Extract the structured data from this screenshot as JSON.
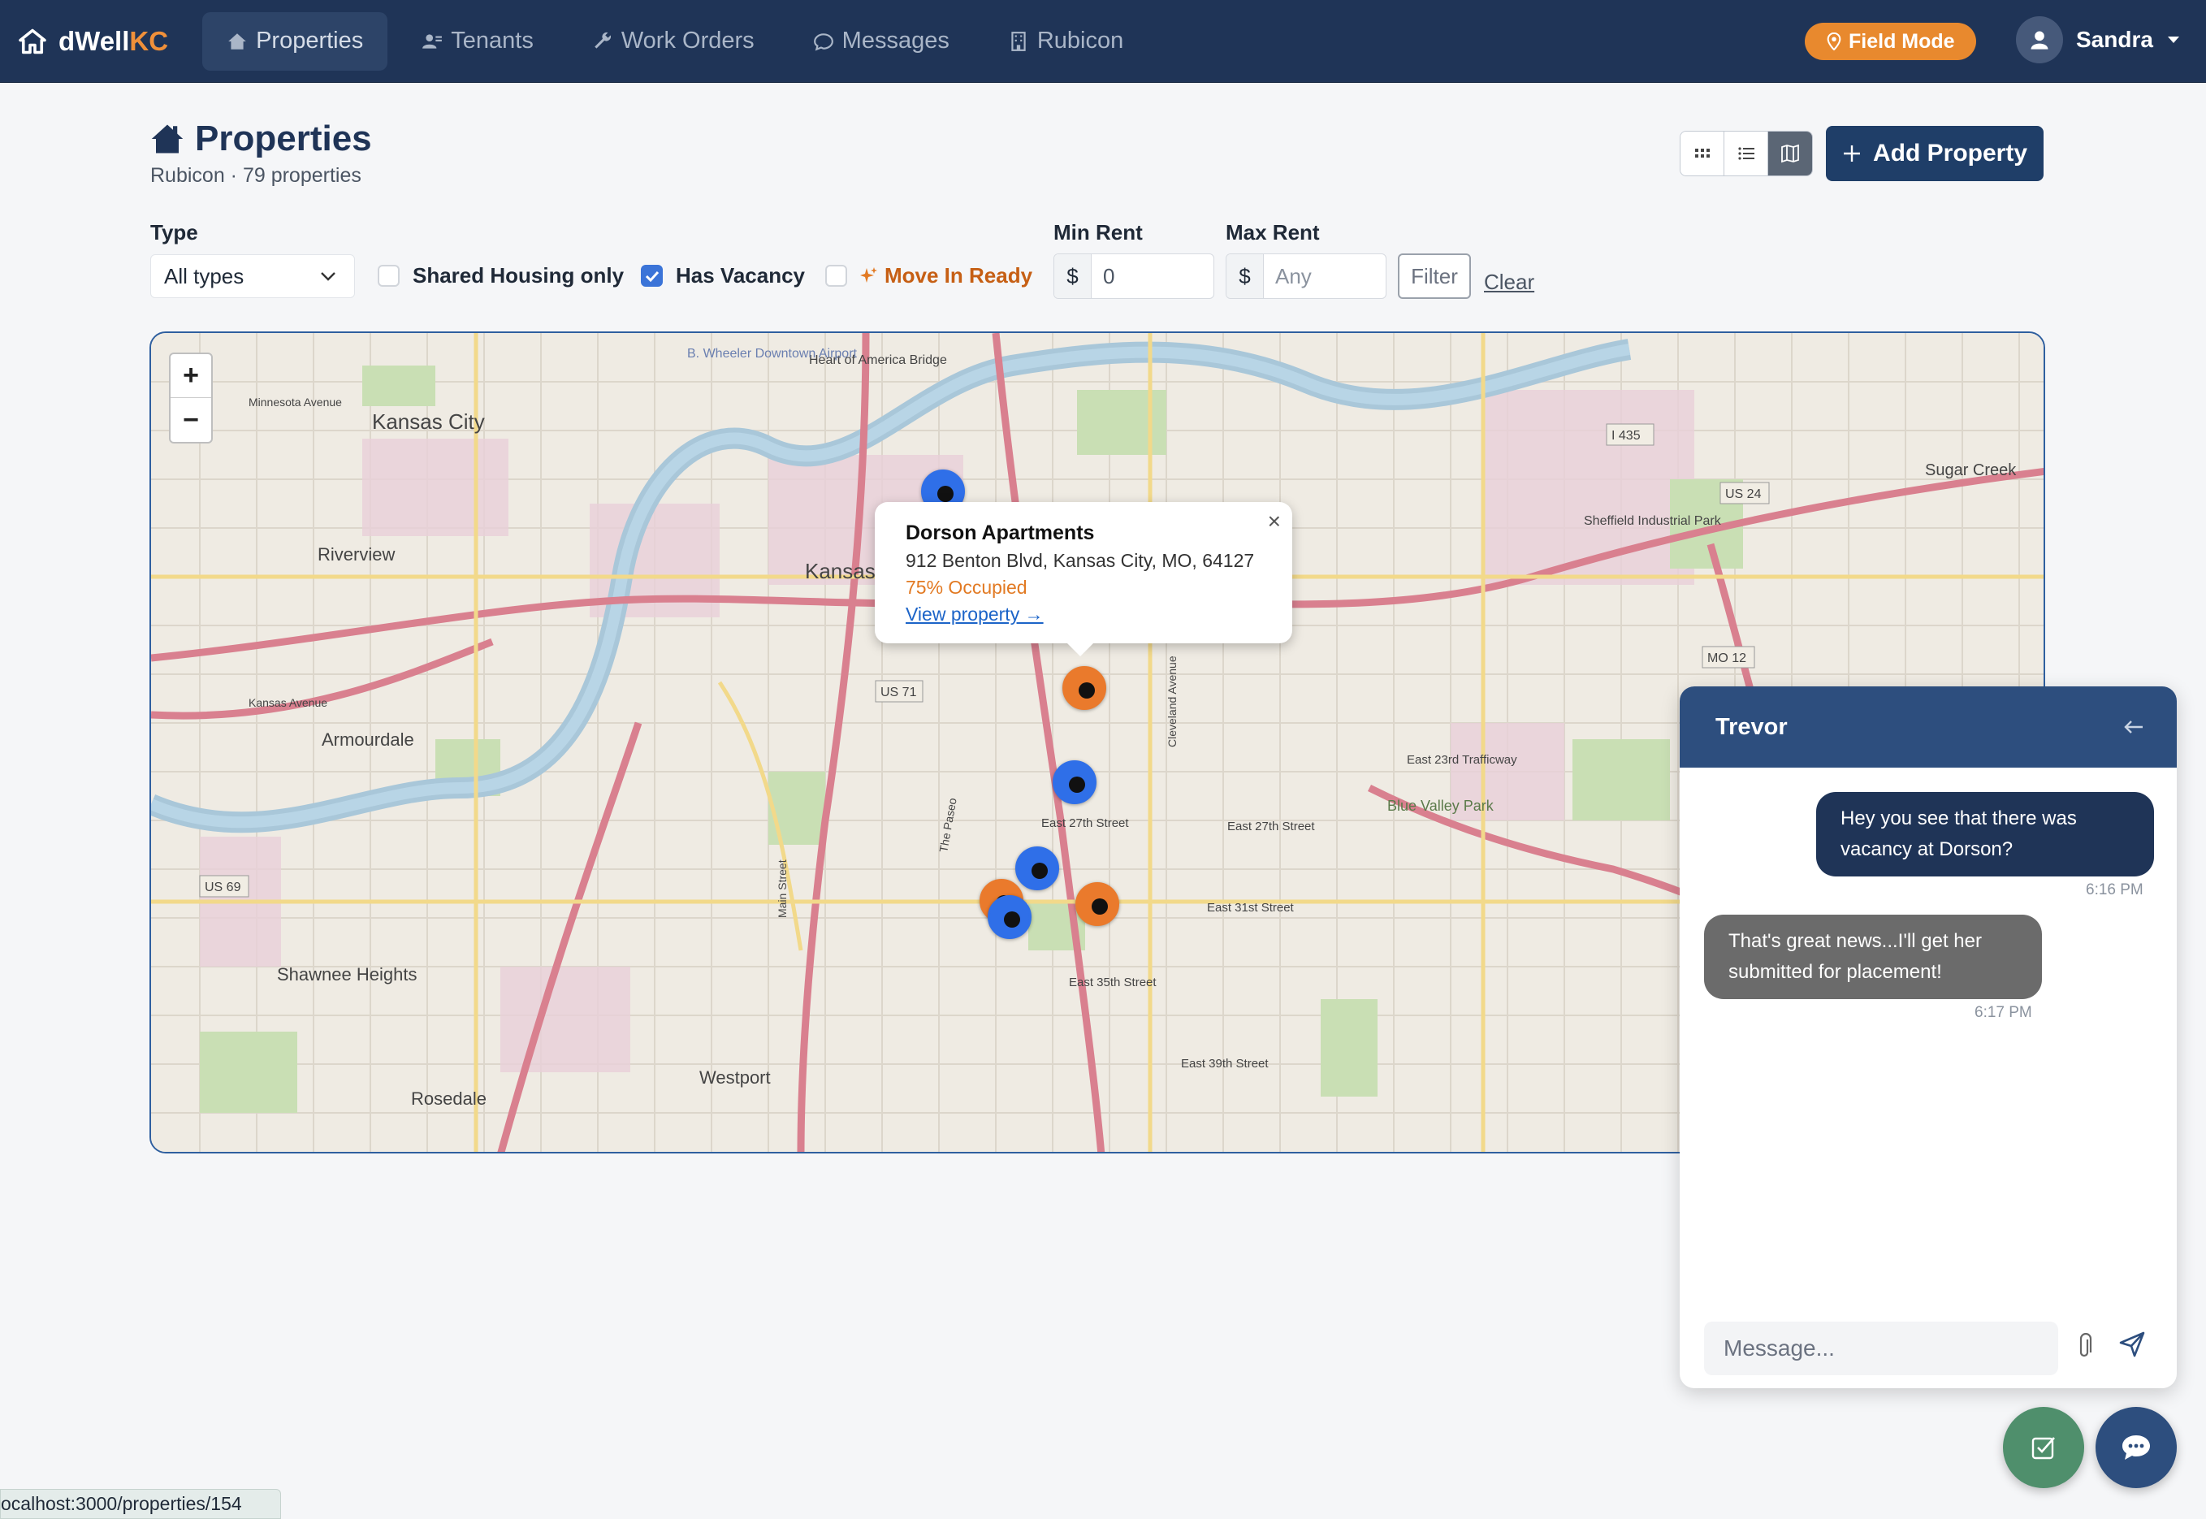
{
  "brand": {
    "name_main": "dWell",
    "name_accent": "KC",
    "accent_color": "#f0903a"
  },
  "nav": [
    {
      "label": "Properties",
      "icon": "house-icon",
      "active": true
    },
    {
      "label": "Tenants",
      "icon": "people-icon"
    },
    {
      "label": "Work Orders",
      "icon": "wrench-icon"
    },
    {
      "label": "Messages",
      "icon": "chat-icon"
    },
    {
      "label": "Rubicon",
      "icon": "building-icon"
    }
  ],
  "field_mode": {
    "label": "Field Mode",
    "icon": "location-pin-icon",
    "color": "#e8892e"
  },
  "user": {
    "name": "Sandra",
    "icon": "user-icon"
  },
  "page": {
    "title": "Properties",
    "subtitle": "Rubicon · 79 properties",
    "add_button": "Add Property",
    "view_modes": [
      "grid-view-icon",
      "list-view-icon",
      "map-view-icon"
    ],
    "active_view": "map-view-icon"
  },
  "filters": {
    "type_label": "Type",
    "type_value": "All types",
    "shared_housing": {
      "label": "Shared Housing only",
      "checked": false
    },
    "has_vacancy": {
      "label": "Has Vacancy",
      "checked": true
    },
    "move_in_ready": {
      "label": "Move In Ready",
      "checked": false,
      "icon": "sparkle-icon"
    },
    "min_rent_label": "Min Rent",
    "min_rent_currency": "$",
    "min_rent_value": "0",
    "max_rent_label": "Max Rent",
    "max_rent_currency": "$",
    "max_rent_placeholder": "Any",
    "filter_button": "Filter",
    "clear_link": "Clear"
  },
  "map": {
    "zoom_in": "+",
    "zoom_out": "−",
    "labels": {
      "kansas_city_ks": "Kansas City",
      "kansas_city_mo": "Kansas City",
      "riverview": "Riverview",
      "armourdale": "Armourdale",
      "shawnee_heights": "Shawnee Heights",
      "rosedale": "Rosedale",
      "westport": "Westport",
      "sugar_creek": "Sugar Creek",
      "heart_of_america_bridge": "Heart of America Bridge",
      "i435": "I 435",
      "us24": "US 24",
      "us71": "US 71",
      "us69": "US 69",
      "mo12": "MO 12",
      "east_27th": "East 27th Street",
      "east_31st": "East 31st Street",
      "east_35th": "East 35th Street",
      "east_39th": "East 39th Street",
      "east_23rd_trafficway": "East 23rd Trafficway",
      "minnesota_avenue": "Minnesota Avenue",
      "kansas_avenue": "Kansas Avenue",
      "cleveland_avenue": "Cleveland Avenue",
      "the_paseo": "The Paseo",
      "main_street": "Main Street",
      "blue_valley_park": "Blue Valley Park",
      "sheffield_park": "Sheffield Industrial Park",
      "wheeler_airport": "B. Wheeler Downtown Airport"
    },
    "markers": [
      {
        "color": "blue"
      },
      {
        "color": "orange"
      },
      {
        "color": "blue"
      },
      {
        "color": "blue"
      },
      {
        "color": "orange"
      },
      {
        "color": "blue"
      },
      {
        "color": "orange"
      }
    ],
    "popup": {
      "title": "Dorson Apartments",
      "address": "912 Benton Blvd, Kansas City, MO, 64127",
      "occupancy": "75% Occupied",
      "link": "View property →",
      "close": "×"
    }
  },
  "chat": {
    "contact": "Trevor",
    "back_icon": "arrow-left-icon",
    "messages": [
      {
        "direction": "out",
        "text": "Hey you see that there was vacancy at Dorson?",
        "time": "6:16 PM"
      },
      {
        "direction": "in",
        "text": "That's great news...I'll get her submitted for placement!",
        "time": "6:17 PM"
      }
    ],
    "input_placeholder": "Message...",
    "attach_icon": "paperclip-icon",
    "send_icon": "send-icon"
  },
  "fabs": [
    {
      "icon": "checkbox-icon",
      "color": "#4f8f6c"
    },
    {
      "icon": "chat-bubble-icon",
      "color": "#2d4e7e"
    }
  ],
  "status_url": "ocalhost:3000/properties/154"
}
